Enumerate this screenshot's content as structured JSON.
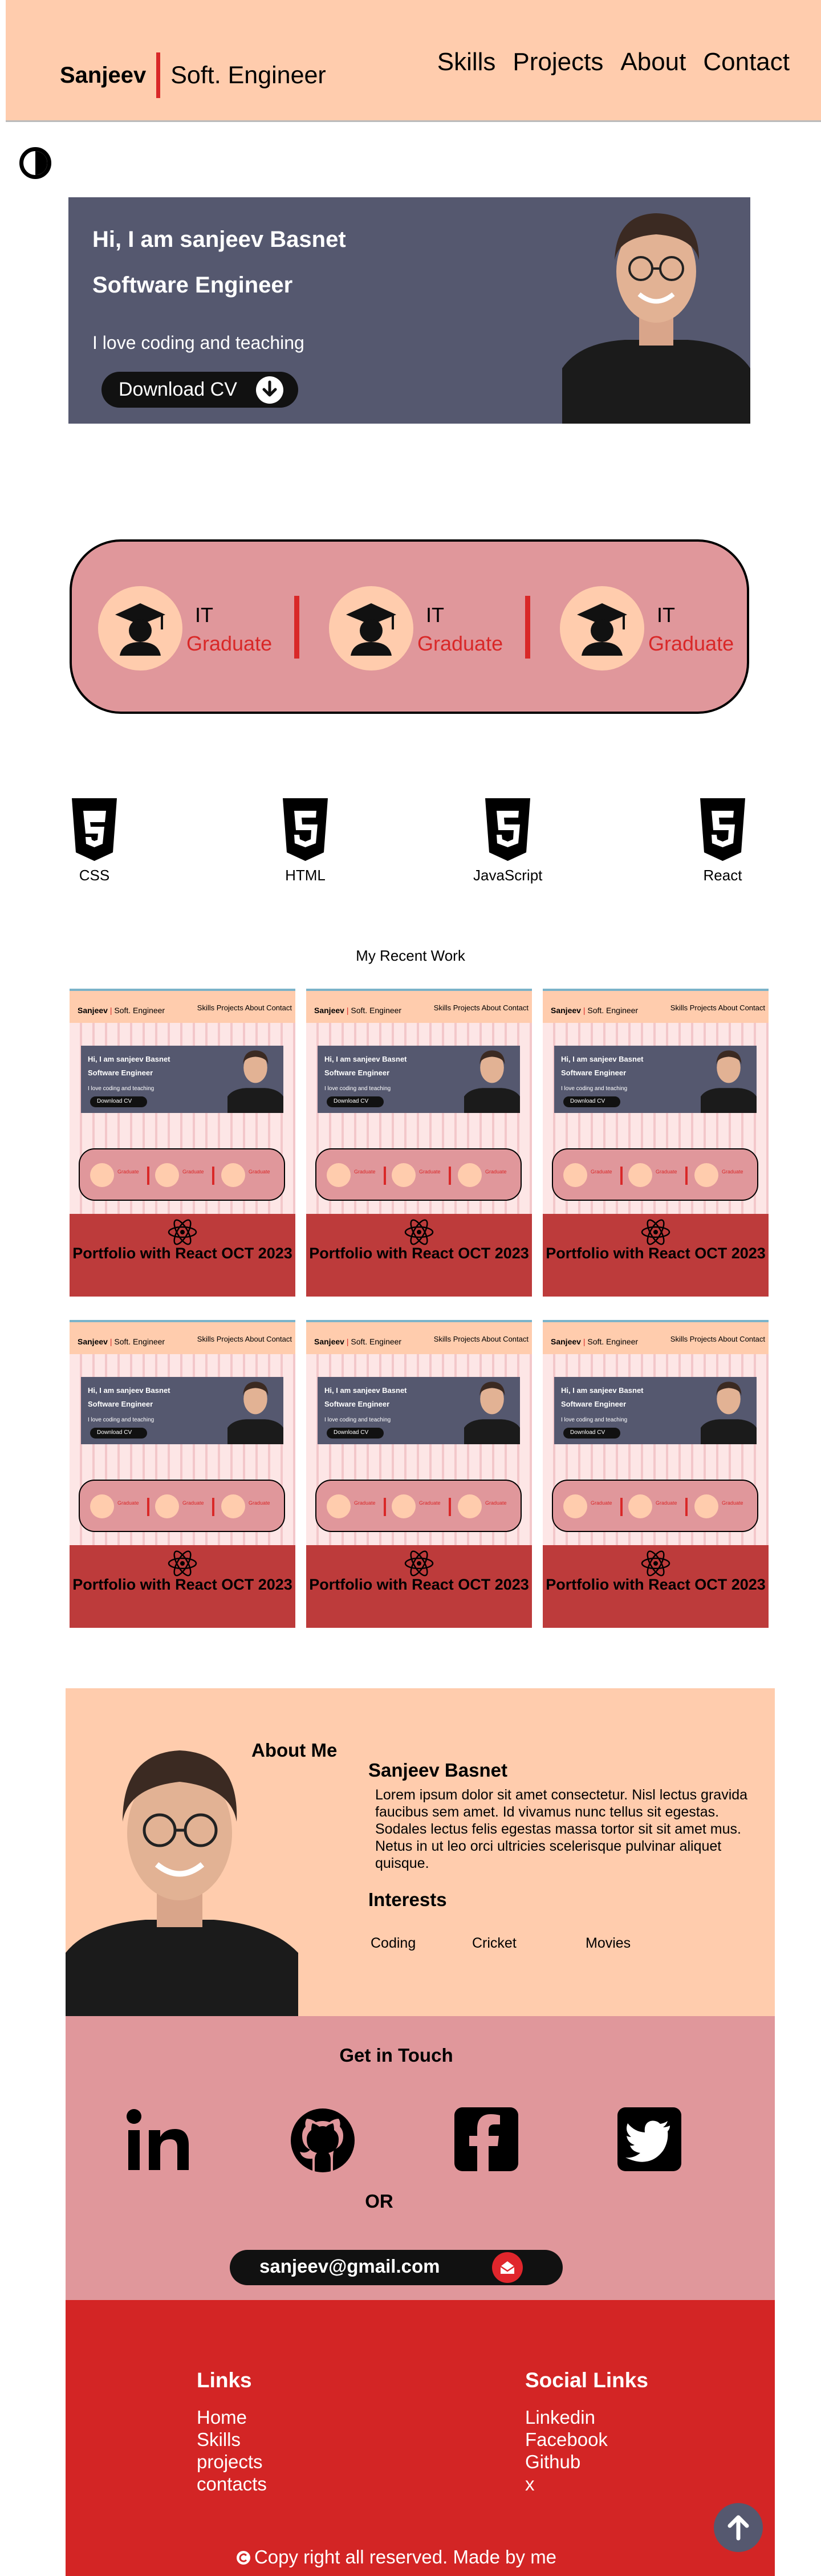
{
  "nav": {
    "brand_name": "Sanjeev",
    "brand_role": "Soft. Engineer",
    "links": [
      "Skills",
      "Projects",
      "About",
      "Contact"
    ]
  },
  "hero": {
    "greeting": "Hi, I am sanjeev Basnet",
    "role": "Software Engineer",
    "tagline": "I love coding and teaching",
    "cv_button": "Download CV"
  },
  "stats": [
    {
      "line1": "IT",
      "line2": "Graduate"
    },
    {
      "line1": "IT",
      "line2": "Graduate"
    },
    {
      "line1": "IT",
      "line2": "Graduate"
    }
  ],
  "skills": [
    "CSS",
    "HTML",
    "JavaScript",
    "React"
  ],
  "projects": {
    "title": "My Recent Work",
    "card_title": "Portfolio with React OCT 2023",
    "count": 6
  },
  "about": {
    "title": "About Me",
    "name": "Sanjeev Basnet",
    "text": "Lorem ipsum dolor sit amet consectetur. Nisl lectus gravida faucibus sem amet. Id vivamus nunc tellus sit egestas. Sodales lectus felis egestas massa tortor sit sit amet mus. Netus in ut leo orci ultricies scelerisque pulvinar aliquet quisque.",
    "interests_title": "Interests",
    "interests": [
      "Coding",
      "Cricket",
      "Movies"
    ]
  },
  "contact": {
    "title": "Get in Touch",
    "or": "OR",
    "email": "sanjeev@gmail.com",
    "icons": [
      "linkedin-icon",
      "github-icon",
      "facebook-icon",
      "twitter-icon"
    ]
  },
  "footer": {
    "links_title": "Links",
    "links": [
      "Home",
      "Skills",
      "projects",
      "contacts"
    ],
    "social_title": "Social Links",
    "social": [
      "Linkedin",
      "Facebook",
      "Github",
      "x"
    ],
    "copyright": "Copy right all reserved. Made by me"
  },
  "colors": {
    "peach": "#ffccad",
    "rose": "#e0979b",
    "red": "#d32525",
    "slate": "#55586f"
  }
}
